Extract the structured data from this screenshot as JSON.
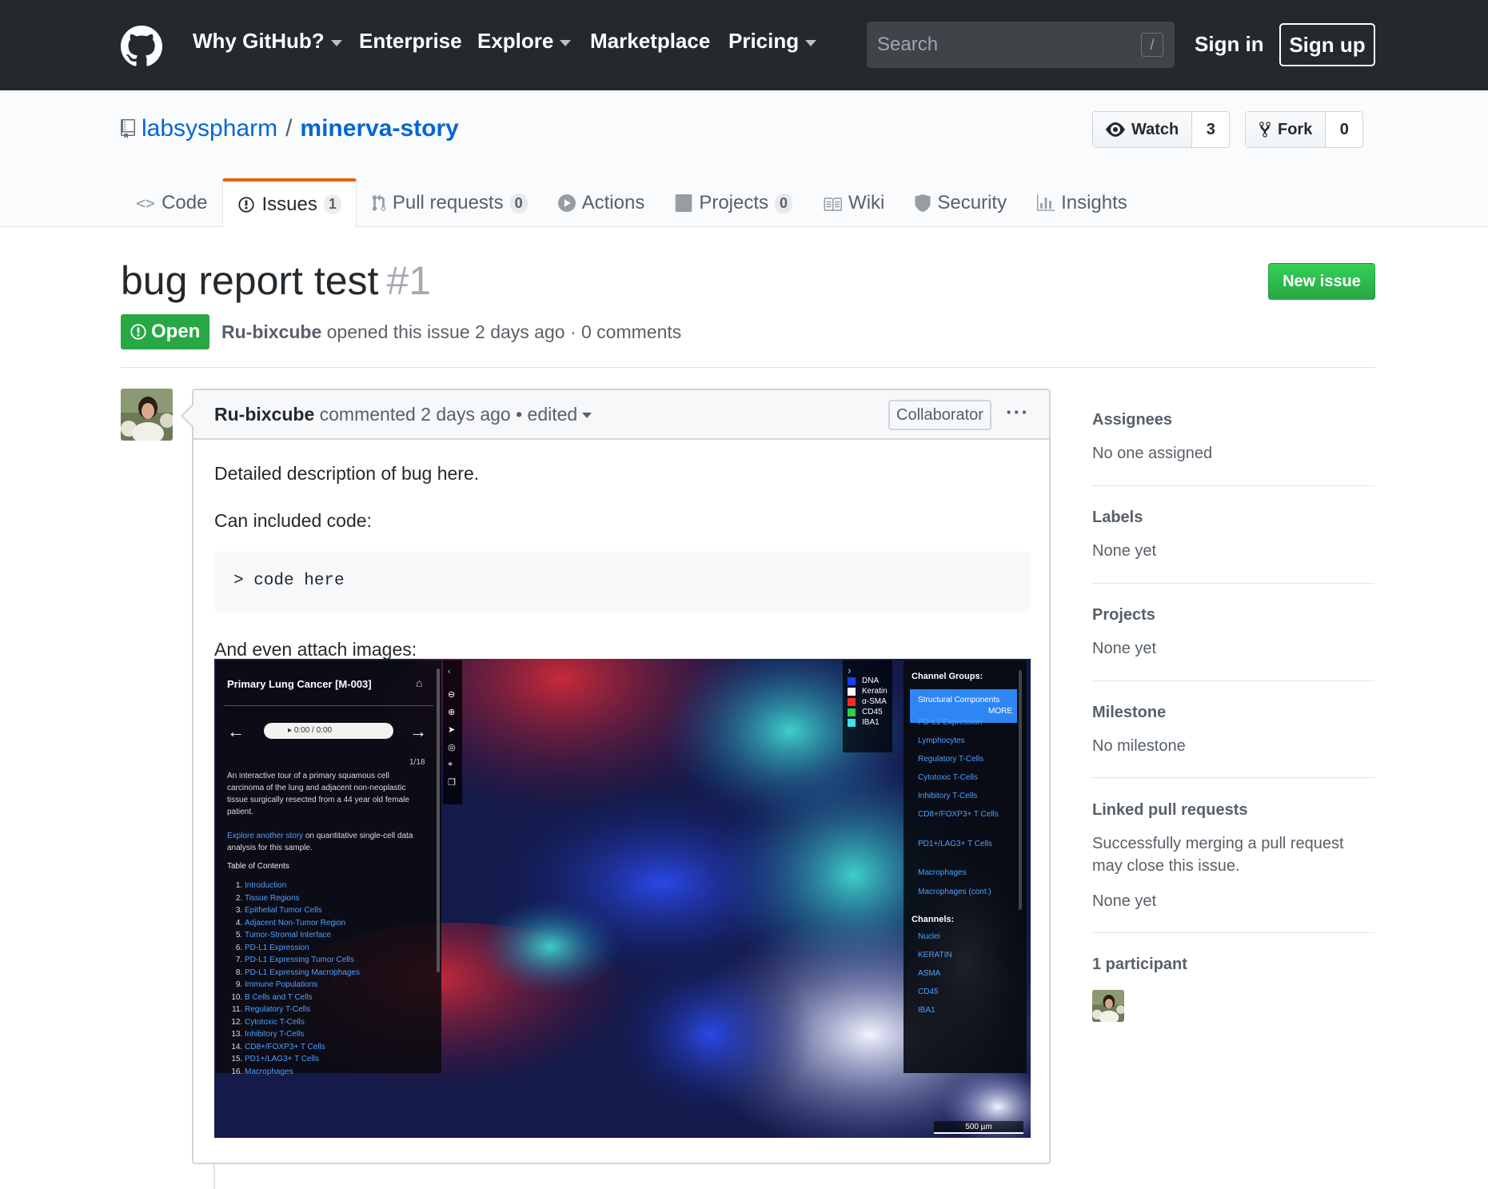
{
  "header": {
    "nav": [
      {
        "label": "Why GitHub?",
        "caret": true
      },
      {
        "label": "Enterprise",
        "caret": false
      },
      {
        "label": "Explore",
        "caret": true
      },
      {
        "label": "Marketplace",
        "caret": false
      },
      {
        "label": "Pricing",
        "caret": true
      }
    ],
    "search_placeholder": "Search",
    "search_shortcut": "/",
    "sign_in": "Sign in",
    "sign_up": "Sign up"
  },
  "repo": {
    "owner": "labsyspharm",
    "separator": "/",
    "name": "minerva-story",
    "watch_label": "Watch",
    "watch_count": "3",
    "fork_label": "Fork",
    "fork_count": "0",
    "tabs": [
      {
        "label": "Code",
        "counter": "",
        "icon": "code-icon"
      },
      {
        "label": "Issues",
        "counter": "1",
        "icon": "issue-opened-icon",
        "selected": true
      },
      {
        "label": "Pull requests",
        "counter": "0",
        "icon": "git-pull-request-icon"
      },
      {
        "label": "Actions",
        "counter": "",
        "icon": "play-icon"
      },
      {
        "label": "Projects",
        "counter": "0",
        "icon": "project-icon"
      },
      {
        "label": "Wiki",
        "counter": "",
        "icon": "book-icon"
      },
      {
        "label": "Security",
        "counter": "",
        "icon": "shield-icon"
      },
      {
        "label": "Insights",
        "counter": "",
        "icon": "graph-icon"
      }
    ]
  },
  "issue": {
    "title": "bug report test",
    "number": "#1",
    "new_issue": "New issue",
    "state": "Open",
    "author": "Ru-bixcube",
    "meta_rest": "opened this issue 2 days ago · 0 comments"
  },
  "comment": {
    "author": "Ru-bixcube",
    "action": "commented 2 days ago",
    "edited": "• edited",
    "badge": "Collaborator",
    "menu": "···",
    "line1": "Detailed description of bug here.",
    "line2": "Can included code:",
    "code": "> code here",
    "line3": "And even attach images:"
  },
  "screenshot": {
    "title": "Primary Lung Cancer [M-003]",
    "audio": "0:00 / 0:00",
    "page": "1/18",
    "description": "An interactive tour of a primary squamous cell carcinoma of the lung and adjacent non-neoplastic tissue surgically resected from a 44 year old female patient.",
    "explore_link": "Explore another story",
    "explore_rest": "on quantitative single-cell data analysis for this sample.",
    "toc_title": "Table of Contents",
    "toc": [
      "Introduction",
      "Tissue Regions",
      "Epithelial Tumor Cells",
      "Adjacent Non-Tumor Region",
      "Tumor-Stromal Interface",
      "PD-L1 Expression",
      "PD-L1 Expressing Tumor Cells",
      "PD-L1 Expressing Macrophages",
      "Immune Populations",
      "B Cells and T Cells",
      "Regulatory T-Cells",
      "Cytotoxic T-Cells",
      "Inhibitory T-Cells",
      "CD8+/FOXP3+ T Cells",
      "PD1+/LAG3+ T Cells",
      "Macrophages"
    ],
    "legend": [
      {
        "label": "DNA",
        "color": "#1f3dff"
      },
      {
        "label": "Keratin",
        "color": "#ffffff"
      },
      {
        "label": "α-SMA",
        "color": "#ff2a2a"
      },
      {
        "label": "CD45",
        "color": "#2bd14a"
      },
      {
        "label": "IBA1",
        "color": "#46e0e6"
      }
    ],
    "groups_title": "Channel Groups:",
    "selected_group": "Structural Components",
    "more": "MORE",
    "groups": [
      "PD-L1 Expression",
      "Lymphocytes",
      "Regulatory T-Cells",
      "Cytotoxic T-Cells",
      "Inhibitory T-Cells",
      "CD8+/FOXP3+ T Cells",
      "PD1+/LAG3+ T Cells",
      "Macrophages",
      "Macrophages (cont.)"
    ],
    "channels_title": "Channels:",
    "channels": [
      "Nuclei",
      "KERATIN",
      "ASMA",
      "CD45",
      "IBA1"
    ],
    "scale": "500 µm"
  },
  "sidebar": {
    "assignees_h": "Assignees",
    "assignees_v": "No one assigned",
    "labels_h": "Labels",
    "labels_v": "None yet",
    "projects_h": "Projects",
    "projects_v": "None yet",
    "milestone_h": "Milestone",
    "milestone_v": "No milestone",
    "linked_h": "Linked pull requests",
    "linked_v": "Successfully merging a pull request may close this issue.",
    "linked_v2": "None yet",
    "participants_h": "1 participant"
  },
  "colors": {
    "header_bg": "#24292e",
    "link": "#0366d6",
    "open_green": "#28a745",
    "tab_accent": "#e36209"
  }
}
